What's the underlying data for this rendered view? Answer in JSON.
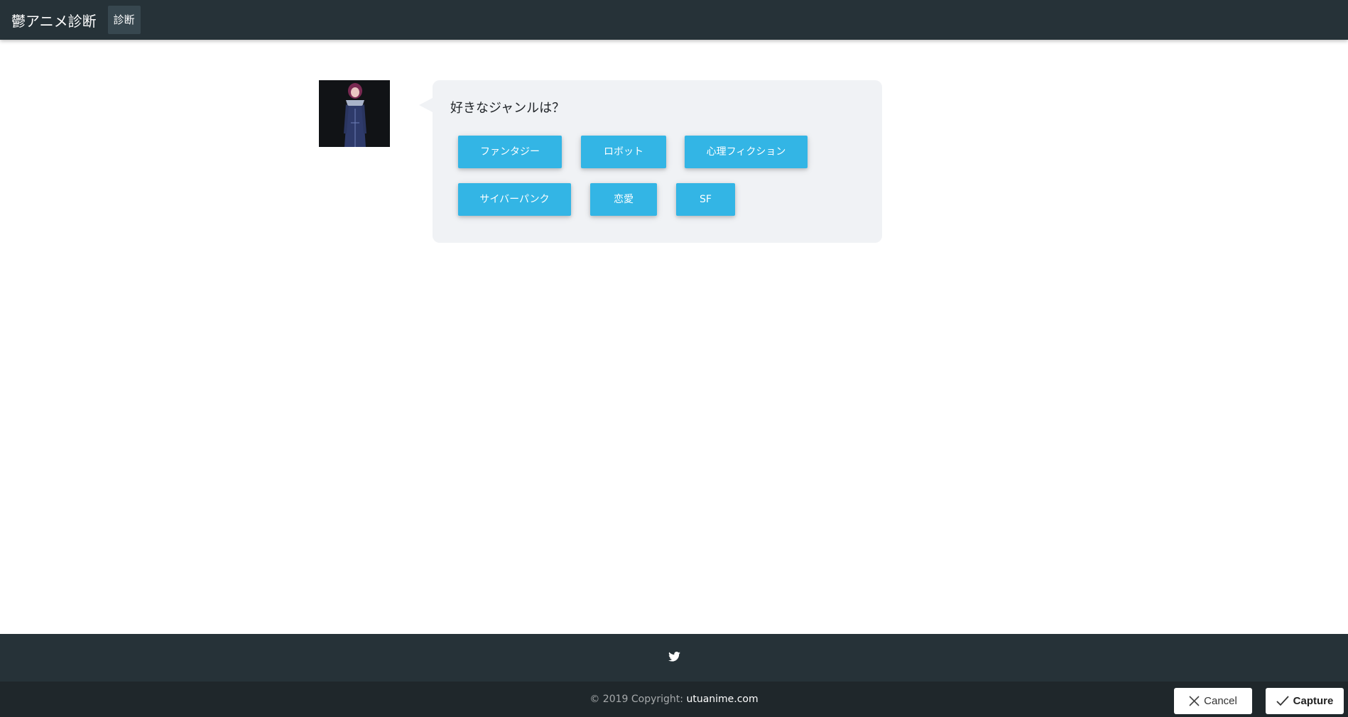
{
  "navbar": {
    "brand": "鬱アニメ診断",
    "nav_item": "診断"
  },
  "quiz": {
    "question": "好きなジャンルは？",
    "options": [
      "ファンタジー",
      "ロボット",
      "心理フィクション",
      "サイバーパンク",
      "恋愛",
      "SF"
    ],
    "button_color": "#33b5e5"
  },
  "footer": {
    "social_icon": "twitter-icon",
    "copyright_prefix": "© 2019 Copyright:",
    "copyright_site": "utuanime.com"
  },
  "overlay": {
    "cancel_label": "Cancel",
    "capture_label": "Capture"
  },
  "colors": {
    "navbar": "#263238",
    "footer_bottom": "#1f272b",
    "bubble": "#f0f2f5"
  }
}
